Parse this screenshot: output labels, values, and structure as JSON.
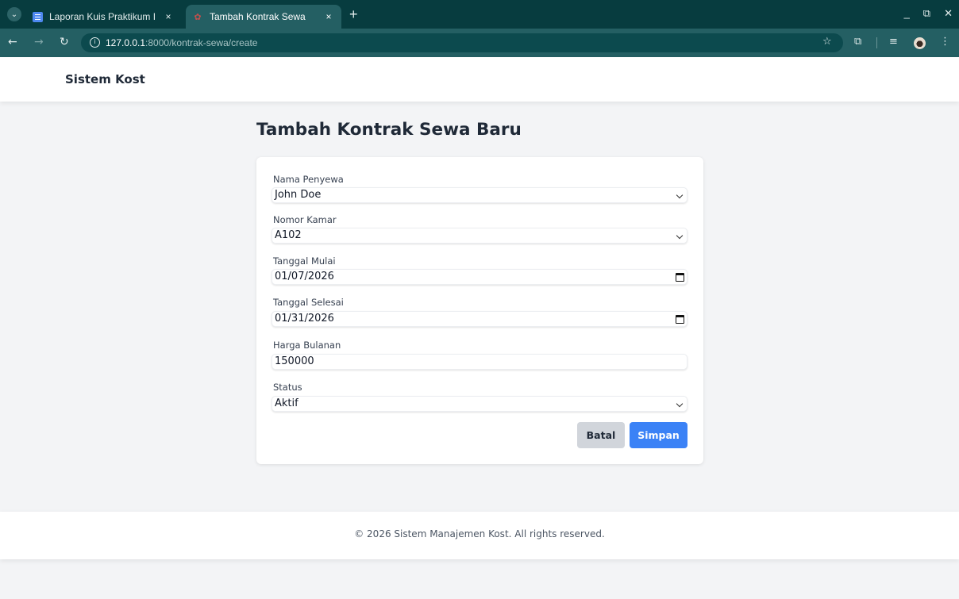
{
  "browser": {
    "tabs": [
      {
        "title": "Laporan Kuis Praktikum I",
        "close": "×"
      },
      {
        "title": "Tambah Kontrak Sewa",
        "close": "×"
      }
    ],
    "new_tab": "+",
    "url_host": "127.0.0.1",
    "url_path": ":8000/kontrak-sewa/create",
    "window_controls": [
      "_",
      "⧉",
      "✕"
    ],
    "icons": [
      "back-icon",
      "forward-icon",
      "reload-icon",
      "site-info-icon",
      "bookmark-star-icon",
      "extensions-icon",
      "media-controls-icon",
      "profile-avatar",
      "more-menu-icon"
    ]
  },
  "site": {
    "brand": "Sistem Kost",
    "footer": "© 2026 Sistem Manajemen Kost. All rights reserved."
  },
  "form": {
    "title": "Tambah Kontrak Sewa Baru",
    "fields": [
      {
        "label": "Nama Penyewa",
        "value": "John Doe",
        "type": "select"
      },
      {
        "label": "Nomor Kamar",
        "value": "A102",
        "type": "select"
      },
      {
        "label": "Tanggal Mulai",
        "value": "01/07/2026",
        "type": "date"
      },
      {
        "label": "Tanggal Selesai",
        "value": "01/31/2026",
        "type": "date"
      },
      {
        "label": "Harga Bulanan",
        "value": "150000",
        "type": "number"
      },
      {
        "label": "Status",
        "value": "Aktif",
        "type": "select"
      }
    ],
    "cancel_label": "Batal",
    "save_label": "Simpan"
  },
  "colors": {
    "tabbar": "#073c3f",
    "toolbar": "#245f63",
    "primary_button": "#3b82f6",
    "cancel_button": "#d1d5db",
    "page_background": "#f3f4f6"
  }
}
